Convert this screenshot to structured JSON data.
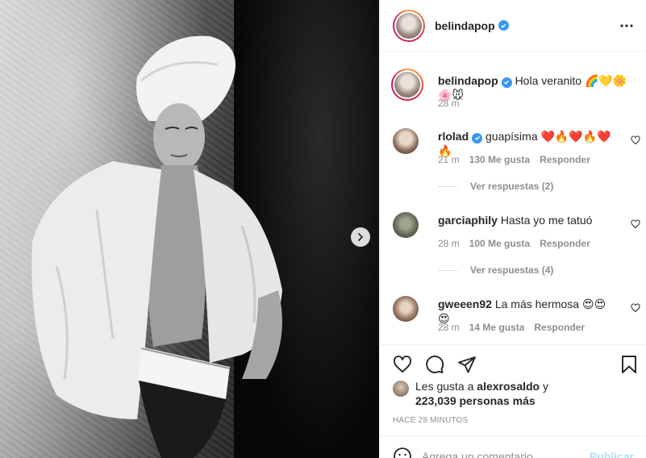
{
  "post": {
    "author": "belindapop",
    "more_icon": "ellipsis-icon",
    "next_icon": "chevron-right-icon"
  },
  "caption": {
    "username": "belindapop",
    "text": "Hola veranito 🌈💛🌼🌸🐭",
    "time": "28 m"
  },
  "comments": [
    {
      "username": "rlolad",
      "verified": true,
      "text": "guapísima ❤️🔥❤️🔥❤️🔥",
      "time": "21 m",
      "likes": "130 Me gusta",
      "reply": "Responder",
      "view_replies": "Ver respuestas (2)"
    },
    {
      "username": "garciaphily",
      "verified": false,
      "text": "Hasta yo me tatuó",
      "time": "28 m",
      "likes": "100 Me gusta",
      "reply": "Responder",
      "view_replies": "Ver respuestas (4)"
    },
    {
      "username": "gweeen92",
      "verified": false,
      "text": "La más hermosa 😍😍😍",
      "time": "28 m",
      "likes": "14 Me gusta",
      "reply": "Responder"
    }
  ],
  "likes": {
    "prefix": "Les gusta a",
    "liker": "alexrosaldo",
    "joiner": "y",
    "count": "223,039 personas más"
  },
  "timestamp": "HACE 28 MINUTOS",
  "add_comment": {
    "placeholder": "Agrega un comentario...",
    "post_label": "Publicar"
  },
  "colors": {
    "verified": "#3897f0",
    "muted": "#8e8e8e",
    "text": "#262626",
    "post_disabled": "#b2dffc"
  }
}
